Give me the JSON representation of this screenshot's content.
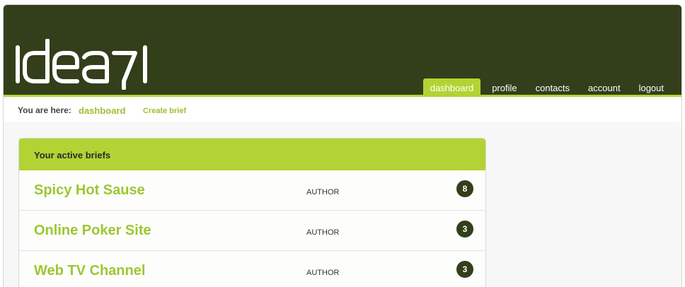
{
  "app": {
    "logo_text": "idea7i",
    "accent_color": "#b3d335",
    "header_color": "#323f1a"
  },
  "nav": {
    "items": [
      {
        "label": "dashboard",
        "active": true
      },
      {
        "label": "profile",
        "active": false
      },
      {
        "label": "contacts",
        "active": false
      },
      {
        "label": "account",
        "active": false
      },
      {
        "label": "logout",
        "active": false
      }
    ]
  },
  "breadcrumb": {
    "prefix": "You are here:",
    "current": "dashboard",
    "action": "Create brief"
  },
  "briefs": {
    "heading": "Your active briefs",
    "items": [
      {
        "title": "Spicy Hot Sause",
        "role": "AUTHOR",
        "count": "8"
      },
      {
        "title": "Online Poker Site",
        "role": "AUTHOR",
        "count": "3"
      },
      {
        "title": "Web TV Channel",
        "role": "AUTHOR",
        "count": "3"
      }
    ]
  }
}
